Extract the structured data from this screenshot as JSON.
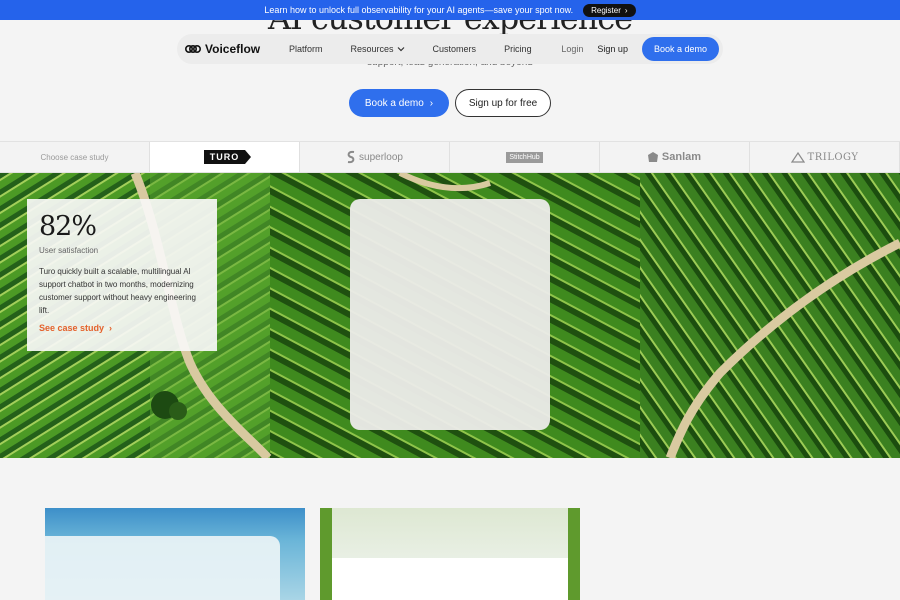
{
  "announcement": {
    "text": "Learn how to unlock full observability for your AI agents—save your spot now.",
    "button_label": "Register"
  },
  "hero": {
    "title_fragment": "AI customer experience",
    "subtitle_fragment": "support, lead generation, and beyond"
  },
  "nav": {
    "brand": "Voiceflow",
    "links": [
      "Platform",
      "Resources",
      "Customers",
      "Pricing"
    ],
    "login": "Login",
    "signup": "Sign up",
    "demo": "Book a demo"
  },
  "cta": {
    "primary": "Book a demo",
    "secondary": "Sign up for free"
  },
  "case_tabs": {
    "label": "Choose case study",
    "items": [
      "TURO",
      "superloop",
      "StitchHub",
      "Sanlam",
      "TRILOGY"
    ],
    "active": "TURO"
  },
  "stat": {
    "value": "82%",
    "label": "User satisfaction",
    "description": "Turo quickly built a scalable, multilingual AI support chatbot in two months, modernizing customer support without heavy engineering lift.",
    "link": "See case study"
  },
  "colors": {
    "accent": "#2f6fed",
    "link_orange": "#e4622c",
    "announce_bg": "#2563eb"
  }
}
